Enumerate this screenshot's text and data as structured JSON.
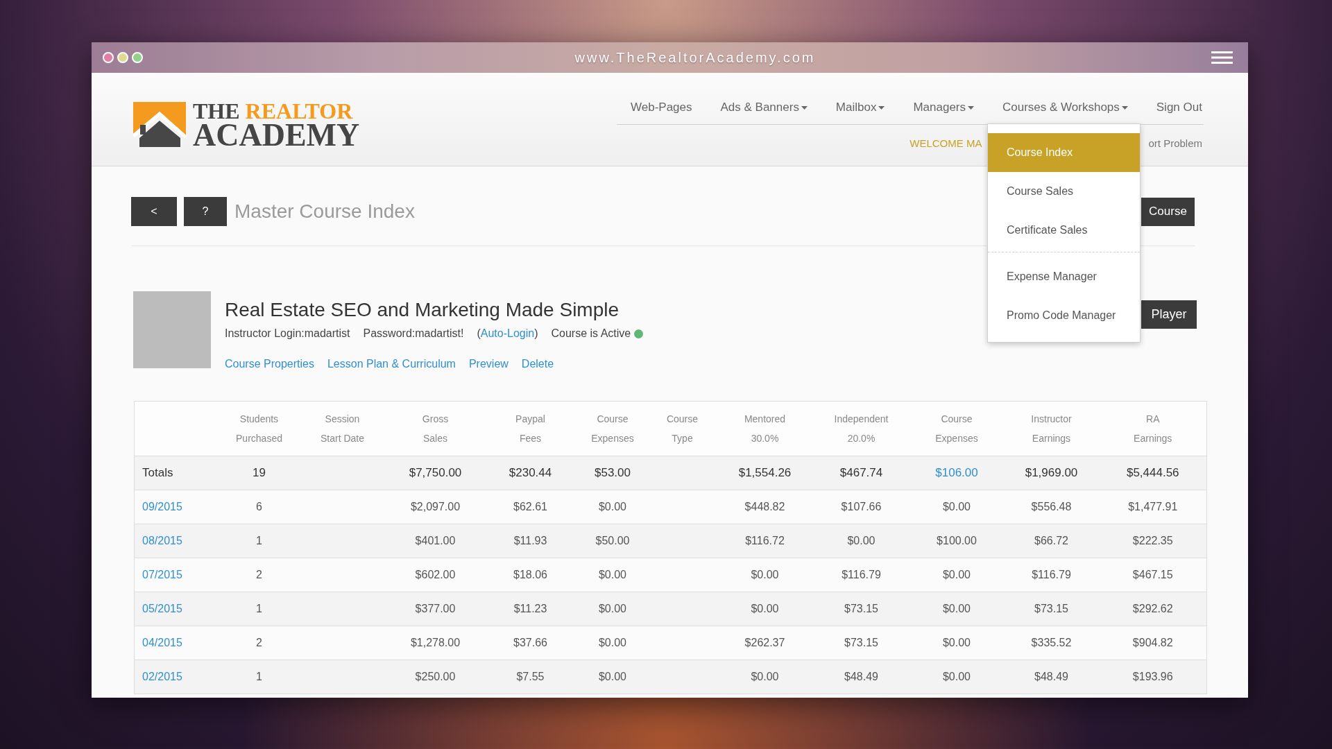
{
  "window": {
    "url": "www.TheRealtorAcademy.com"
  },
  "logo": {
    "line_1": [
      "THE",
      "REALTOR"
    ],
    "line_2": "ACADEMY"
  },
  "nav": {
    "items": [
      {
        "label": "Web-Pages",
        "dropdown": false
      },
      {
        "label": "Ads & Banners",
        "dropdown": true
      },
      {
        "label": "Mailbox",
        "dropdown": true
      },
      {
        "label": "Managers",
        "dropdown": true
      },
      {
        "label": "Courses & Workshops",
        "dropdown": true,
        "menu": {
          "groups": [
            {
              "items": [
                {
                  "label": "Course Index",
                  "selected": true
                },
                {
                  "label": "Course Sales",
                  "selected": false
                },
                {
                  "label": "Certificate Sales",
                  "selected": false
                }
              ]
            },
            {
              "items": [
                {
                  "label": "Expense Manager",
                  "selected": false
                },
                {
                  "label": "Promo Code Manager",
                  "selected": false
                }
              ]
            }
          ]
        }
      },
      {
        "label": "Sign Out",
        "dropdown": false
      }
    ],
    "welcome": "WELCOME MA",
    "report": "ort Problem"
  },
  "toolbar": {
    "buttons": [
      {
        "kind": "back",
        "label": "<"
      },
      {
        "kind": "help",
        "label": "?"
      }
    ],
    "title": "Master Course Index",
    "action": "Course"
  },
  "course": {
    "title": "Real Estate SEO and Marketing Made Simple",
    "instructor_login": "Instructor Login:madartist",
    "password": "Password:madartist!",
    "auto_login": "(Auto-Login)",
    "status": {
      "label": "Course is Active",
      "active": true
    },
    "links": [
      "Course Properties",
      "Lesson Plan & Curriculum",
      "Preview",
      "Delete"
    ],
    "player_button": "Player"
  },
  "table": {
    "columns": [
      "",
      {
        "lines": [
          "Students",
          "Purchased"
        ]
      },
      {
        "lines": [
          "Session",
          "Start Date"
        ]
      },
      {
        "lines": [
          "Gross",
          "Sales"
        ]
      },
      {
        "lines": [
          "Paypal",
          "Fees"
        ]
      },
      {
        "lines": [
          "Course",
          "Expenses"
        ]
      },
      {
        "lines": [
          "Course",
          "Type"
        ]
      },
      {
        "lines": [
          "Mentored",
          "30.0%"
        ]
      },
      {
        "lines": [
          "Independent",
          "20.0%"
        ]
      },
      {
        "lines": [
          "Course",
          "Expenses"
        ]
      },
      {
        "lines": [
          "Instructor",
          "Earnings"
        ]
      },
      {
        "lines": [
          "RA",
          "Earnings"
        ]
      }
    ],
    "rows": [
      {
        "kind": "totals",
        "cells": [
          "Totals",
          "19",
          null,
          "$7,750.00",
          "$230.44",
          "$53.00",
          null,
          "$1,554.26",
          "$467.74",
          {
            "text": "$106.00",
            "link": true
          },
          "$1,969.00",
          "$5,444.56"
        ]
      },
      {
        "kind": "session",
        "cells": [
          {
            "text": "09/2015",
            "link": true
          },
          "6",
          null,
          "$2,097.00",
          "$62.61",
          "$0.00",
          null,
          "$448.82",
          "$107.66",
          "$0.00",
          "$556.48",
          "$1,477.91"
        ]
      },
      {
        "kind": "session",
        "cells": [
          {
            "text": "08/2015",
            "link": true
          },
          "1",
          null,
          "$401.00",
          "$11.93",
          "$50.00",
          null,
          "$116.72",
          "$0.00",
          "$100.00",
          "$66.72",
          "$222.35"
        ]
      },
      {
        "kind": "session",
        "cells": [
          {
            "text": "07/2015",
            "link": true
          },
          "2",
          null,
          "$602.00",
          "$18.06",
          "$0.00",
          null,
          "$0.00",
          "$116.79",
          "$0.00",
          "$116.79",
          "$467.15"
        ]
      },
      {
        "kind": "session",
        "cells": [
          {
            "text": "05/2015",
            "link": true
          },
          "1",
          null,
          "$377.00",
          "$11.23",
          "$0.00",
          null,
          "$0.00",
          "$73.15",
          "$0.00",
          "$73.15",
          "$292.62"
        ]
      },
      {
        "kind": "session",
        "cells": [
          {
            "text": "04/2015",
            "link": true
          },
          "2",
          null,
          "$1,278.00",
          "$37.66",
          "$0.00",
          null,
          "$262.37",
          "$73.15",
          "$0.00",
          "$335.52",
          "$904.82"
        ]
      },
      {
        "kind": "session",
        "cells": [
          {
            "text": "02/2015",
            "link": true
          },
          "1",
          null,
          "$250.00",
          "$7.55",
          "$0.00",
          null,
          "$0.00",
          "$48.49",
          "$0.00",
          "$48.49",
          "$193.96"
        ]
      }
    ]
  }
}
